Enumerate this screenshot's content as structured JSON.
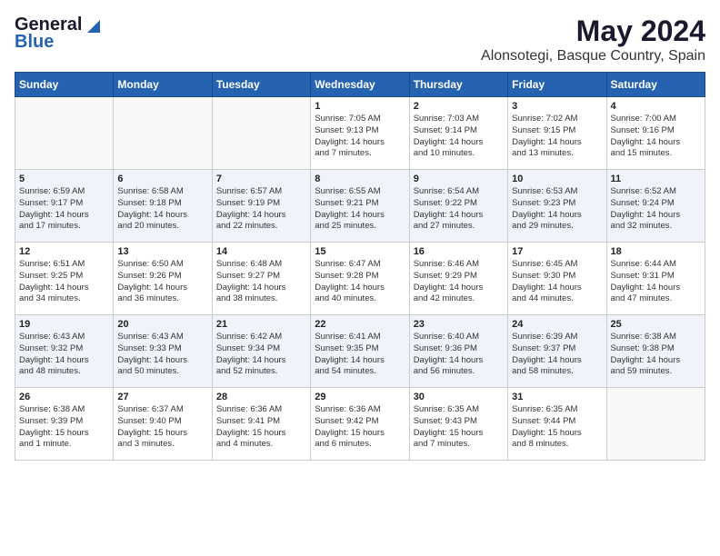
{
  "logo": {
    "general": "General",
    "blue": "Blue"
  },
  "title": "May 2024",
  "location": "Alonsotegi, Basque Country, Spain",
  "days_of_week": [
    "Sunday",
    "Monday",
    "Tuesday",
    "Wednesday",
    "Thursday",
    "Friday",
    "Saturday"
  ],
  "weeks": [
    [
      {
        "day": "",
        "info": ""
      },
      {
        "day": "",
        "info": ""
      },
      {
        "day": "",
        "info": ""
      },
      {
        "day": "1",
        "info": "Sunrise: 7:05 AM\nSunset: 9:13 PM\nDaylight: 14 hours\nand 7 minutes."
      },
      {
        "day": "2",
        "info": "Sunrise: 7:03 AM\nSunset: 9:14 PM\nDaylight: 14 hours\nand 10 minutes."
      },
      {
        "day": "3",
        "info": "Sunrise: 7:02 AM\nSunset: 9:15 PM\nDaylight: 14 hours\nand 13 minutes."
      },
      {
        "day": "4",
        "info": "Sunrise: 7:00 AM\nSunset: 9:16 PM\nDaylight: 14 hours\nand 15 minutes."
      }
    ],
    [
      {
        "day": "5",
        "info": "Sunrise: 6:59 AM\nSunset: 9:17 PM\nDaylight: 14 hours\nand 17 minutes."
      },
      {
        "day": "6",
        "info": "Sunrise: 6:58 AM\nSunset: 9:18 PM\nDaylight: 14 hours\nand 20 minutes."
      },
      {
        "day": "7",
        "info": "Sunrise: 6:57 AM\nSunset: 9:19 PM\nDaylight: 14 hours\nand 22 minutes."
      },
      {
        "day": "8",
        "info": "Sunrise: 6:55 AM\nSunset: 9:21 PM\nDaylight: 14 hours\nand 25 minutes."
      },
      {
        "day": "9",
        "info": "Sunrise: 6:54 AM\nSunset: 9:22 PM\nDaylight: 14 hours\nand 27 minutes."
      },
      {
        "day": "10",
        "info": "Sunrise: 6:53 AM\nSunset: 9:23 PM\nDaylight: 14 hours\nand 29 minutes."
      },
      {
        "day": "11",
        "info": "Sunrise: 6:52 AM\nSunset: 9:24 PM\nDaylight: 14 hours\nand 32 minutes."
      }
    ],
    [
      {
        "day": "12",
        "info": "Sunrise: 6:51 AM\nSunset: 9:25 PM\nDaylight: 14 hours\nand 34 minutes."
      },
      {
        "day": "13",
        "info": "Sunrise: 6:50 AM\nSunset: 9:26 PM\nDaylight: 14 hours\nand 36 minutes."
      },
      {
        "day": "14",
        "info": "Sunrise: 6:48 AM\nSunset: 9:27 PM\nDaylight: 14 hours\nand 38 minutes."
      },
      {
        "day": "15",
        "info": "Sunrise: 6:47 AM\nSunset: 9:28 PM\nDaylight: 14 hours\nand 40 minutes."
      },
      {
        "day": "16",
        "info": "Sunrise: 6:46 AM\nSunset: 9:29 PM\nDaylight: 14 hours\nand 42 minutes."
      },
      {
        "day": "17",
        "info": "Sunrise: 6:45 AM\nSunset: 9:30 PM\nDaylight: 14 hours\nand 44 minutes."
      },
      {
        "day": "18",
        "info": "Sunrise: 6:44 AM\nSunset: 9:31 PM\nDaylight: 14 hours\nand 47 minutes."
      }
    ],
    [
      {
        "day": "19",
        "info": "Sunrise: 6:43 AM\nSunset: 9:32 PM\nDaylight: 14 hours\nand 48 minutes."
      },
      {
        "day": "20",
        "info": "Sunrise: 6:43 AM\nSunset: 9:33 PM\nDaylight: 14 hours\nand 50 minutes."
      },
      {
        "day": "21",
        "info": "Sunrise: 6:42 AM\nSunset: 9:34 PM\nDaylight: 14 hours\nand 52 minutes."
      },
      {
        "day": "22",
        "info": "Sunrise: 6:41 AM\nSunset: 9:35 PM\nDaylight: 14 hours\nand 54 minutes."
      },
      {
        "day": "23",
        "info": "Sunrise: 6:40 AM\nSunset: 9:36 PM\nDaylight: 14 hours\nand 56 minutes."
      },
      {
        "day": "24",
        "info": "Sunrise: 6:39 AM\nSunset: 9:37 PM\nDaylight: 14 hours\nand 58 minutes."
      },
      {
        "day": "25",
        "info": "Sunrise: 6:38 AM\nSunset: 9:38 PM\nDaylight: 14 hours\nand 59 minutes."
      }
    ],
    [
      {
        "day": "26",
        "info": "Sunrise: 6:38 AM\nSunset: 9:39 PM\nDaylight: 15 hours\nand 1 minute."
      },
      {
        "day": "27",
        "info": "Sunrise: 6:37 AM\nSunset: 9:40 PM\nDaylight: 15 hours\nand 3 minutes."
      },
      {
        "day": "28",
        "info": "Sunrise: 6:36 AM\nSunset: 9:41 PM\nDaylight: 15 hours\nand 4 minutes."
      },
      {
        "day": "29",
        "info": "Sunrise: 6:36 AM\nSunset: 9:42 PM\nDaylight: 15 hours\nand 6 minutes."
      },
      {
        "day": "30",
        "info": "Sunrise: 6:35 AM\nSunset: 9:43 PM\nDaylight: 15 hours\nand 7 minutes."
      },
      {
        "day": "31",
        "info": "Sunrise: 6:35 AM\nSunset: 9:44 PM\nDaylight: 15 hours\nand 8 minutes."
      },
      {
        "day": "",
        "info": ""
      }
    ]
  ]
}
